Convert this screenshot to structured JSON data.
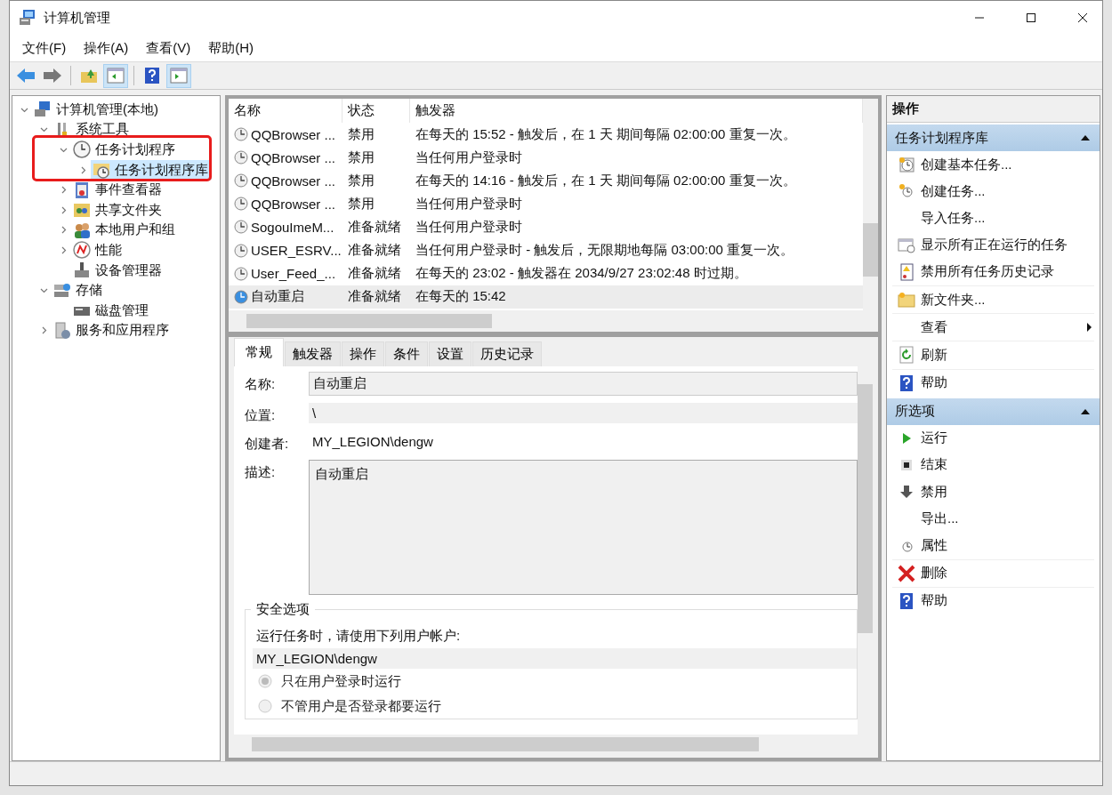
{
  "window": {
    "title": "计算机管理"
  },
  "menu": [
    "文件(F)",
    "操作(A)",
    "查看(V)",
    "帮助(H)"
  ],
  "toolbar": [
    {
      "pressed": false
    },
    {
      "pressed": false
    },
    {
      "pressed": false
    },
    {
      "pressed": true
    },
    {
      "pressed": false
    },
    {
      "pressed": true
    }
  ],
  "tree": [
    {
      "label": "计算机管理(本地)",
      "expanded": true,
      "selected": false,
      "children": [
        {
          "label": "系统工具",
          "expanded": true,
          "selected": false,
          "children": [
            {
              "label": "任务计划程序",
              "expanded": true,
              "selected": false,
              "children": [
                {
                  "label": "任务计划程序库",
                  "expanded": false,
                  "selected": true
                }
              ]
            },
            {
              "label": "事件查看器",
              "expanded": false,
              "selected": false
            },
            {
              "label": "共享文件夹",
              "expanded": false,
              "selected": false
            },
            {
              "label": "本地用户和组",
              "expanded": false,
              "selected": false
            },
            {
              "label": "性能",
              "expanded": false,
              "selected": false
            },
            {
              "label": "设备管理器",
              "selected": false
            }
          ]
        },
        {
          "label": "存储",
          "expanded": true,
          "selected": false,
          "children": [
            {
              "label": "磁盘管理",
              "selected": false
            }
          ]
        },
        {
          "label": "服务和应用程序",
          "expanded": false,
          "selected": false
        }
      ]
    }
  ],
  "task_table": {
    "columns": [
      "名称",
      "状态",
      "触发器"
    ],
    "rows": [
      {
        "name": "QQBrowser ...",
        "status": "禁用",
        "trigger": "在每天的 15:52 - 触发后，在 1 天 期间每隔 02:00:00 重复一次。",
        "selected": false
      },
      {
        "name": "QQBrowser ...",
        "status": "禁用",
        "trigger": "当任何用户登录时",
        "selected": false
      },
      {
        "name": "QQBrowser ...",
        "status": "禁用",
        "trigger": "在每天的 14:16 - 触发后，在 1 天 期间每隔 02:00:00 重复一次。",
        "selected": false
      },
      {
        "name": "QQBrowser ...",
        "status": "禁用",
        "trigger": "当任何用户登录时",
        "selected": false
      },
      {
        "name": "SogouImeM...",
        "status": "准备就绪",
        "trigger": "当任何用户登录时",
        "selected": false
      },
      {
        "name": "USER_ESRV...",
        "status": "准备就绪",
        "trigger": "当任何用户登录时 - 触发后，无限期地每隔 03:00:00 重复一次。",
        "selected": false
      },
      {
        "name": "User_Feed_...",
        "status": "准备就绪",
        "trigger": "在每天的 23:02 - 触发器在 2034/9/27 23:02:48 时过期。",
        "selected": false
      },
      {
        "name": "自动重启",
        "status": "准备就绪",
        "trigger": "在每天的 15:42",
        "selected": true
      }
    ]
  },
  "detail_tabs": [
    {
      "label": "常规",
      "selected": true
    },
    {
      "label": "触发器",
      "selected": false
    },
    {
      "label": "操作",
      "selected": false
    },
    {
      "label": "条件",
      "selected": false
    },
    {
      "label": "设置",
      "selected": false
    },
    {
      "label": "历史记录",
      "selected": false
    }
  ],
  "general": {
    "name_label": "名称:",
    "name_value": "自动重启",
    "location_label": "位置:",
    "location_value": "\\",
    "author_label": "创建者:",
    "author_value": "MY_LEGION\\dengw",
    "description_label": "描述:",
    "description_value": "自动重启",
    "security": {
      "title": "安全选项",
      "prompt": "运行任务时，请使用下列用户帐户:",
      "account": "MY_LEGION\\dengw",
      "options": [
        {
          "label": "只在用户登录时运行",
          "selected": true,
          "disabled": true
        },
        {
          "label": "不管用户是否登录都要运行",
          "selected": false,
          "disabled": true
        }
      ]
    }
  },
  "actions": {
    "title": "操作",
    "sections": [
      {
        "title": "任务计划程序库",
        "expanded": true,
        "items": [
          {
            "label": "创建基本任务...",
            "submenu": false
          },
          {
            "label": "创建任务...",
            "submenu": false
          },
          {
            "label": "导入任务...",
            "submenu": false
          },
          {
            "label": "显示所有正在运行的任务",
            "submenu": false
          },
          {
            "label": "禁用所有任务历史记录",
            "submenu": false
          },
          {
            "label": "新文件夹...",
            "submenu": false
          },
          {
            "label": "查看",
            "submenu": true
          },
          {
            "label": "刷新",
            "submenu": false
          },
          {
            "label": "帮助",
            "submenu": false
          }
        ]
      },
      {
        "title": "所选项",
        "expanded": true,
        "items": [
          {
            "label": "运行",
            "submenu": false
          },
          {
            "label": "结束",
            "submenu": false
          },
          {
            "label": "禁用",
            "submenu": false
          },
          {
            "label": "导出...",
            "submenu": false
          },
          {
            "label": "属性",
            "submenu": false
          },
          {
            "label": "删除",
            "submenu": false
          },
          {
            "label": "帮助",
            "submenu": false
          }
        ]
      }
    ]
  }
}
